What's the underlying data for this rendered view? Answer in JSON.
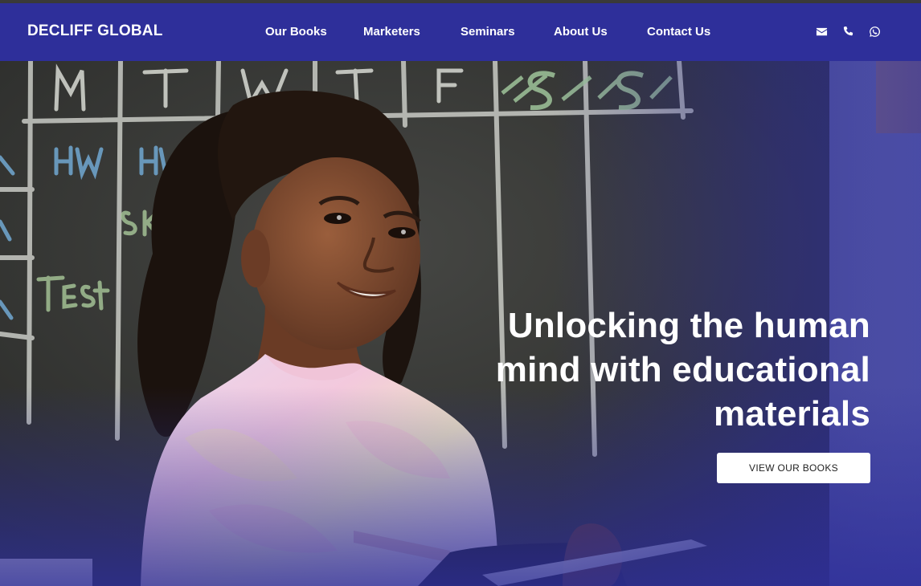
{
  "brand": "DECLIFF GLOBAL",
  "nav": {
    "items": [
      {
        "label": "Our Books"
      },
      {
        "label": "Marketers"
      },
      {
        "label": "Seminars"
      },
      {
        "label": "About Us"
      },
      {
        "label": "Contact Us"
      }
    ],
    "icons": [
      "envelope-icon",
      "phone-icon",
      "whatsapp-icon"
    ]
  },
  "hero": {
    "headline_lines": [
      "Unlocking the human",
      "mind with educational",
      "materials"
    ],
    "cta_label": "VIEW OUR BOOKS",
    "chalkboard_letters": [
      "M",
      "T",
      "W",
      "T",
      "F",
      "S",
      "S"
    ],
    "chalk_notes": [
      "HW",
      "HW",
      "SKY",
      "TEST"
    ]
  },
  "colors": {
    "nav_bg": "#2e2f9a",
    "accent": "#2e2f9a",
    "text_light": "#ffffff"
  }
}
